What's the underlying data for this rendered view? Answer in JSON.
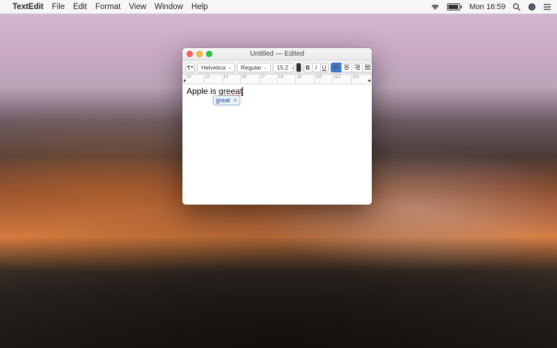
{
  "menubar": {
    "app_name": "TextEdit",
    "items": [
      "File",
      "Edit",
      "Format",
      "View",
      "Window",
      "Help"
    ],
    "status": {
      "battery_pct": "",
      "time": "Mon 16:59"
    }
  },
  "window": {
    "title": "Untitled — Edited",
    "toolbar": {
      "font_family": "Helvetica",
      "font_style": "Regular",
      "font_size": "15.2",
      "bold": "B",
      "italic": "I",
      "underline": "U"
    },
    "ruler": {
      "ticks": [
        "10",
        "12",
        "14",
        "16",
        "17",
        "18",
        "19",
        "110",
        "112",
        "114"
      ]
    },
    "document": {
      "text_prefix": "Apple is ",
      "misspelled": "greeat",
      "suggestion": "great"
    }
  }
}
